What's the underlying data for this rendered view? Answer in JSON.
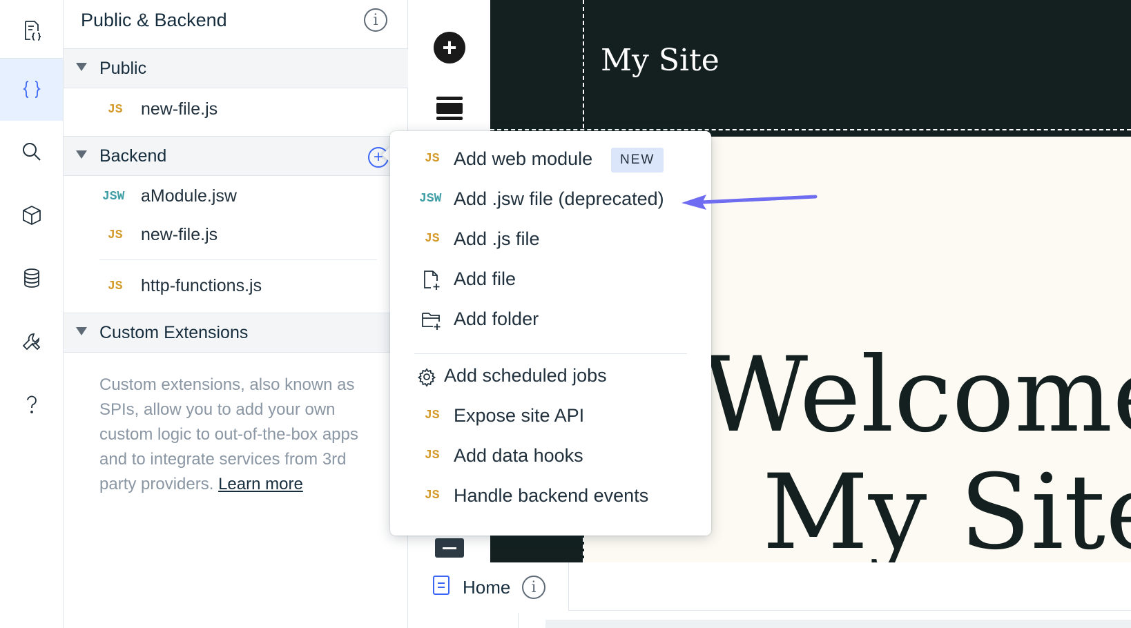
{
  "rail": {
    "items": [
      {
        "name": "code-files-icon",
        "active": false
      },
      {
        "name": "braces-icon",
        "active": true
      },
      {
        "name": "search-icon",
        "active": false
      },
      {
        "name": "package-icon",
        "active": false
      },
      {
        "name": "database-icon",
        "active": false
      },
      {
        "name": "tools-icon",
        "active": false
      },
      {
        "name": "help-icon",
        "active": false
      }
    ]
  },
  "panel": {
    "title": "Public & Backend",
    "info_glyph": "i",
    "sections": {
      "public": {
        "label": "Public"
      },
      "backend": {
        "label": "Backend",
        "add_glyph": "+"
      },
      "custom": {
        "label": "Custom Extensions",
        "description": "Custom extensions, also known as SPIs, allow you to add your own custom logic to out-of-the-box apps and to integrate services from 3rd party providers.",
        "learn_more": "Learn more"
      }
    },
    "public_files": [
      {
        "badge": "JS",
        "name": "new-file.js"
      }
    ],
    "backend_files": [
      {
        "badge": "JSW",
        "name": "aModule.jsw"
      },
      {
        "badge": "JS",
        "name": "new-file.js"
      },
      {
        "badge": "JS",
        "name": "http-functions.js"
      }
    ]
  },
  "tools": {
    "add_glyph": "+"
  },
  "canvas": {
    "site_title": "My Site",
    "hero_line1": "Welcome t",
    "hero_line2": "My Site"
  },
  "page_bar": {
    "page_name": "Home",
    "info_glyph": "i"
  },
  "menu": {
    "items": [
      {
        "icon": "JS",
        "label": "Add web module",
        "badge": "NEW"
      },
      {
        "icon": "JSW",
        "label": "Add .jsw file (deprecated)"
      },
      {
        "icon": "JS",
        "label": "Add .js file"
      },
      {
        "icon": "add-file-icon",
        "label": "Add file"
      },
      {
        "icon": "add-folder-icon",
        "label": "Add folder"
      },
      {
        "icon": "gear-icon",
        "label": "Add scheduled jobs"
      },
      {
        "icon": "JS",
        "label": "Expose site API"
      },
      {
        "icon": "JS",
        "label": "Add data hooks"
      },
      {
        "icon": "JS",
        "label": "Handle backend events"
      }
    ]
  },
  "colors": {
    "accent": "#3b66f5",
    "js_badge": "#d49a2a",
    "jsw_badge": "#3f9fa6",
    "canvas_dark": "#13201f",
    "canvas_light": "#fdfaf3",
    "annotation_arrow": "#6e6cf0"
  }
}
